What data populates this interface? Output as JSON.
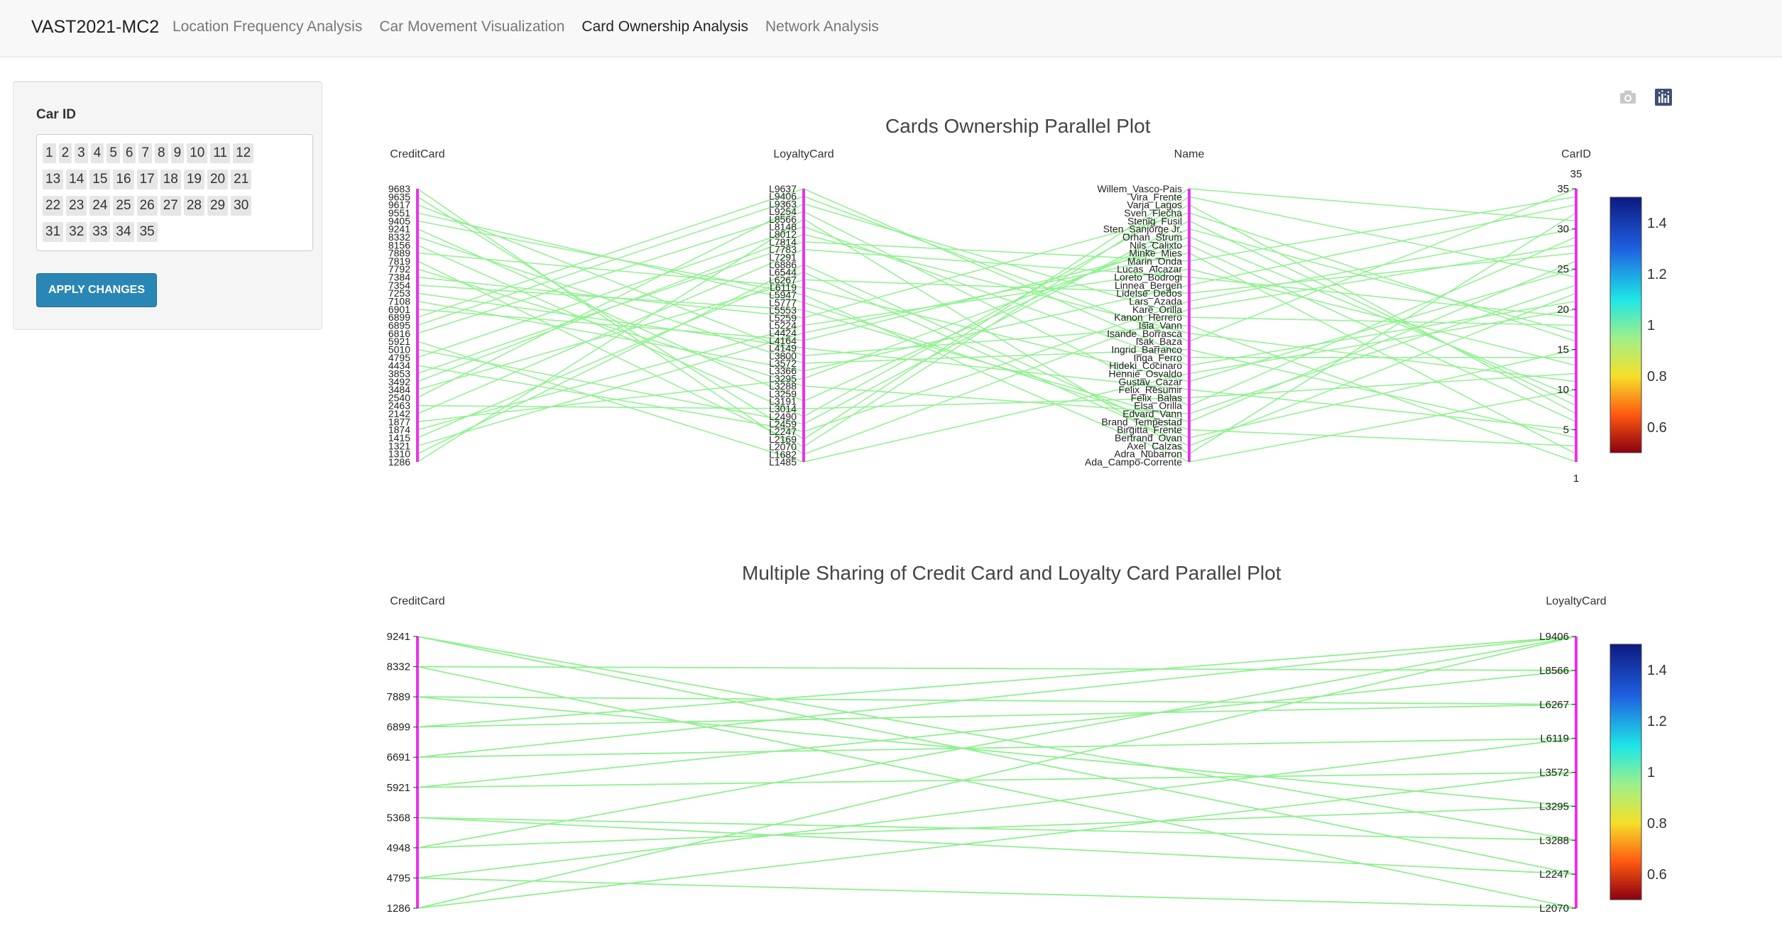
{
  "app": {
    "brand": "VAST2021-MC2"
  },
  "nav": {
    "items": [
      {
        "label": "Location Frequency Analysis",
        "active": false
      },
      {
        "label": "Car Movement Visualization",
        "active": false
      },
      {
        "label": "Card Ownership Analysis",
        "active": true
      },
      {
        "label": "Network Analysis",
        "active": false
      }
    ]
  },
  "sidebar": {
    "car_id_label": "Car ID",
    "rows": [
      [
        "1",
        "2",
        "3",
        "4",
        "5",
        "6",
        "7",
        "8",
        "9",
        "10",
        "11",
        "12"
      ],
      [
        "13",
        "14",
        "15",
        "16",
        "17",
        "18",
        "19",
        "20",
        "21"
      ],
      [
        "22",
        "23",
        "24",
        "25",
        "26",
        "27",
        "28",
        "29",
        "30"
      ],
      [
        "31",
        "32",
        "33",
        "34",
        "35"
      ]
    ],
    "apply_label": "APPLY CHANGES"
  },
  "toolbar": {
    "icons": [
      "camera-icon",
      "plotly-logo-icon"
    ]
  },
  "colors": {
    "axis": "#f02ef0",
    "line": "#8ff08f"
  },
  "chart_data": [
    {
      "type": "parallel_categories",
      "title": "Cards Ownership Parallel Plot",
      "dimensions": [
        {
          "label": "CreditCard",
          "ticks": [
            "9683",
            "9635",
            "9617",
            "9551",
            "9405",
            "9241",
            "8332",
            "8156",
            "7889",
            "7819",
            "7792",
            "7384",
            "7354",
            "7253",
            "7108",
            "6901",
            "6899",
            "6895",
            "6816",
            "5921",
            "5010",
            "4795",
            "4434",
            "3853",
            "3492",
            "3484",
            "2540",
            "2463",
            "2142",
            "1877",
            "1874",
            "1415",
            "1321",
            "1310",
            "1286"
          ]
        },
        {
          "label": "LoyaltyCard",
          "ticks": [
            "L9637",
            "L9406",
            "L9363",
            "L9254",
            "L8566",
            "L8148",
            "L8012",
            "L7814",
            "L7783",
            "L7291",
            "L6886",
            "L6544",
            "L6267",
            "L6119",
            "L5947",
            "L5777",
            "L5553",
            "L5259",
            "L5224",
            "L4424",
            "L4164",
            "L4149",
            "L3800",
            "L3572",
            "L3366",
            "L3295",
            "L3288",
            "L3259",
            "L3191",
            "L3014",
            "L2490",
            "L2459",
            "L2247",
            "L2169",
            "L2070",
            "L1682",
            "L1485"
          ]
        },
        {
          "label": "Name",
          "ticks": [
            "Willem_Vasco-Pais",
            "Vira_Frente",
            "Varja_Lagos",
            "Sven_Flecha",
            "Stenig_Fusil",
            "Sten_Sanjorge Jr.",
            "Orhan_Strum",
            "Nils_Calixto",
            "Minke_Mies",
            "Marin_Onda",
            "Lucas_Alcazar",
            "Loreto_Bodrogi",
            "Linnea_Bergen",
            "Lidelse_Dedos",
            "Lars_Azada",
            "Kare_Orilla",
            "Kanon_Herrero",
            "Isia_Vann",
            "Isande_Borrasca",
            "Isak_Baza",
            "Ingrid_Barranco",
            "Inga_Ferro",
            "Hideki_Cocinaro",
            "Hennie_Osvaldo",
            "Gustav_Cazar",
            "Felix_Resumir",
            "Felix_Balas",
            "Elsa_Orilla",
            "Edvard_Vann",
            "Brand_Tempestad",
            "Birgitta_Frente",
            "Bertrand_Ovan",
            "Axel_Calzas",
            "Adra_Nubarron",
            "Ada_Campo-Corrente"
          ]
        },
        {
          "label": "CarID",
          "ticks": [
            "35",
            "30",
            "25",
            "20",
            "15",
            "10",
            "5"
          ],
          "range": [
            1,
            35
          ],
          "top_label": "35",
          "bottom_label": "1"
        }
      ],
      "colorbar": {
        "ticks": [
          "1.4",
          "1.2",
          "1",
          "0.8",
          "0.6"
        ],
        "range": [
          0.5,
          1.5
        ]
      }
    },
    {
      "type": "parallel_categories",
      "title": "Multiple Sharing of Credit Card and Loyalty Card Parallel Plot",
      "dimensions": [
        {
          "label": "CreditCard",
          "ticks": [
            "9241",
            "8332",
            "7889",
            "6899",
            "6691",
            "5921",
            "5368",
            "4948",
            "4795",
            "1286"
          ]
        },
        {
          "label": "LoyaltyCard",
          "ticks": [
            "L9406",
            "L8566",
            "L6267",
            "L6119",
            "L3572",
            "L3295",
            "L3288",
            "L2247",
            "L2070"
          ]
        }
      ],
      "links": [
        [
          "9241",
          "L2247"
        ],
        [
          "9241",
          "L3288"
        ],
        [
          "8332",
          "L8566"
        ],
        [
          "8332",
          "L2070"
        ],
        [
          "7889",
          "L6267"
        ],
        [
          "7889",
          "L3295"
        ],
        [
          "6899",
          "L9406"
        ],
        [
          "6899",
          "L6267"
        ],
        [
          "6691",
          "L6119"
        ],
        [
          "6691",
          "L9406"
        ],
        [
          "5921",
          "L3572"
        ],
        [
          "5921",
          "L8566"
        ],
        [
          "5368",
          "L3288"
        ],
        [
          "5368",
          "L2247"
        ],
        [
          "4948",
          "L9406"
        ],
        [
          "4948",
          "L3295"
        ],
        [
          "4795",
          "L2070"
        ],
        [
          "4795",
          "L6119"
        ],
        [
          "1286",
          "L9406"
        ],
        [
          "1286",
          "L3572"
        ]
      ],
      "colorbar": {
        "ticks": [
          "1.4",
          "1.2",
          "1",
          "0.8",
          "0.6"
        ],
        "range": [
          0.5,
          1.5
        ]
      }
    }
  ]
}
